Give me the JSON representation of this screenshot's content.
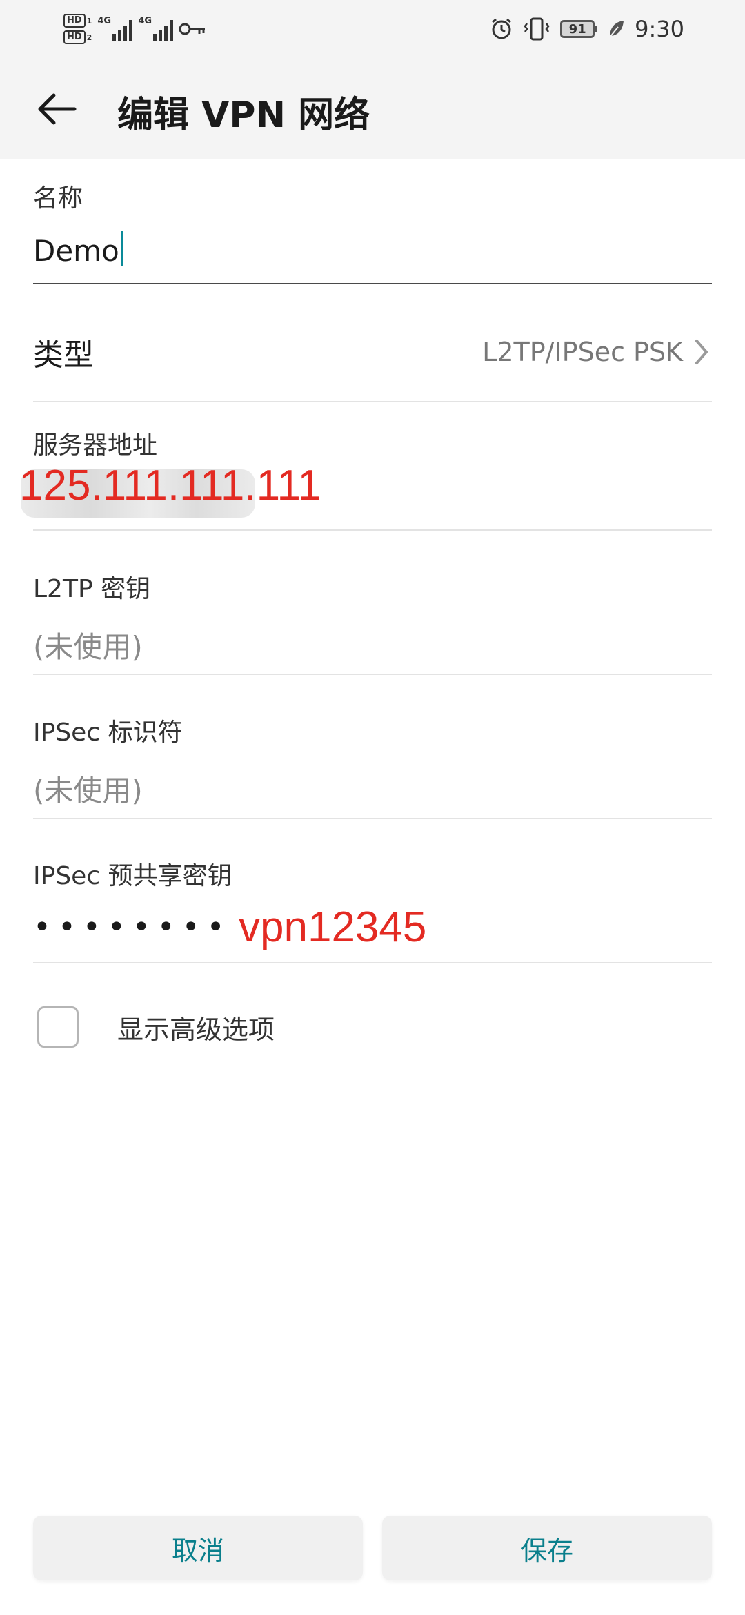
{
  "status_bar": {
    "hd1": "HD",
    "hd1_sim": "1",
    "hd2": "HD",
    "hd2_sim": "2",
    "net1": "4G",
    "net2": "4G",
    "battery_level": "91",
    "time": "9:30",
    "icons": [
      "hd-icon",
      "signal-icon",
      "vpn-key-icon",
      "alarm-icon",
      "vibrate-icon",
      "battery-icon",
      "leaf-icon"
    ]
  },
  "app_bar": {
    "title": "编辑 VPN 网络"
  },
  "form": {
    "name_label": "名称",
    "name_value": "Demo",
    "type_label": "类型",
    "type_value": "L2TP/IPSec PSK",
    "server_label": "服务器地址",
    "server_annotation": "125.111.111.111",
    "l2tp_label": "L2TP 密钥",
    "l2tp_placeholder": "(未使用)",
    "ipsec_id_label": "IPSec 标识符",
    "ipsec_id_placeholder": "(未使用)",
    "ipsec_psk_label": "IPSec 预共享密钥",
    "ipsec_psk_masked": "••••••••",
    "ipsec_psk_annotation": "vpn12345",
    "show_advanced_label": "显示高级选项",
    "show_advanced_checked": false
  },
  "buttons": {
    "cancel": "取消",
    "save": "保存"
  },
  "colors": {
    "accent": "#0a7f8c",
    "annotation": "#e32a22",
    "bar_bg": "#f4f4f4"
  }
}
